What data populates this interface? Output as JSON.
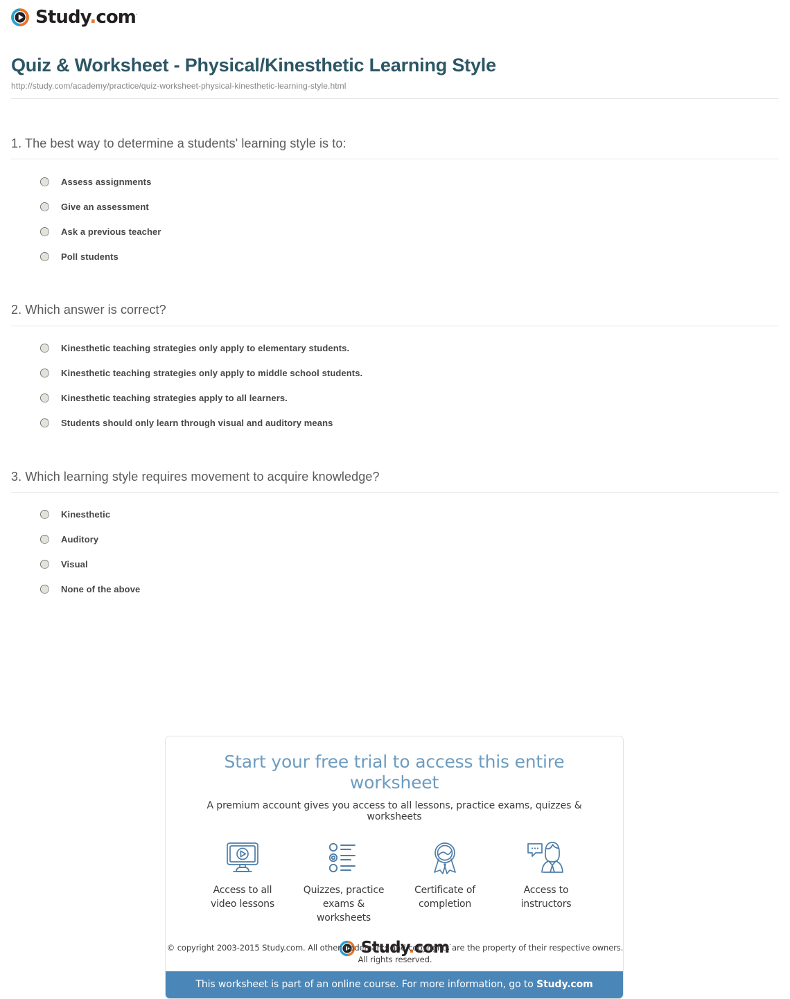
{
  "brand": {
    "name_main": "Study",
    "name_dot": ".",
    "name_tld": "com",
    "trademark": "·",
    "icon": "play-circle-logo",
    "color_blue": "#2a9fd0",
    "color_orange": "#e8762c"
  },
  "header": {
    "title": "Quiz & Worksheet - Physical/Kinesthetic Learning Style",
    "url": "http://study.com/academy/practice/quiz-worksheet-physical-kinesthetic-learning-style.html",
    "title_color": "#2c5664"
  },
  "questions": [
    {
      "number": "1.",
      "text": "1. The best way to determine a students' learning style is to:",
      "options": [
        "Assess assignments",
        "Give an assessment",
        "Ask a previous teacher",
        "Poll students"
      ]
    },
    {
      "number": "2.",
      "text": "2. Which answer is correct?",
      "options": [
        "Kinesthetic teaching strategies only apply to elementary students.",
        "Kinesthetic teaching strategies only apply to middle school students.",
        "Kinesthetic teaching strategies apply to all learners.",
        "Students should only learn through visual and auditory means"
      ]
    },
    {
      "number": "3.",
      "text": "3. Which learning style requires movement to acquire knowledge?",
      "options": [
        "Kinesthetic",
        "Auditory",
        "Visual",
        "None of the above"
      ]
    }
  ],
  "promo": {
    "title": "Start your free trial to access this entire worksheet",
    "subtitle": "A premium account gives you access to all lessons, practice exams, quizzes & worksheets",
    "features": [
      {
        "icon": "monitor-play-icon",
        "line1": "Access to all",
        "line2": "video lessons"
      },
      {
        "icon": "checklist-icon",
        "line1": "Quizzes, practice",
        "line2": "exams & worksheets"
      },
      {
        "icon": "award-ribbon-icon",
        "line1": "Certificate of",
        "line2": "completion"
      },
      {
        "icon": "instructor-chat-icon",
        "line1": "Access to",
        "line2": "instructors"
      }
    ],
    "banner_text": "This worksheet is part of an online course. For more information, go to ",
    "banner_link": "Study.com",
    "banner_color": "#4a86b8",
    "icon_color": "#4d7ea8"
  },
  "footer": {
    "line1": "© copyright 2003-2015 Study.com. All other trademarks and copyrights are the property of their respective owners.",
    "line2": "All rights reserved."
  }
}
